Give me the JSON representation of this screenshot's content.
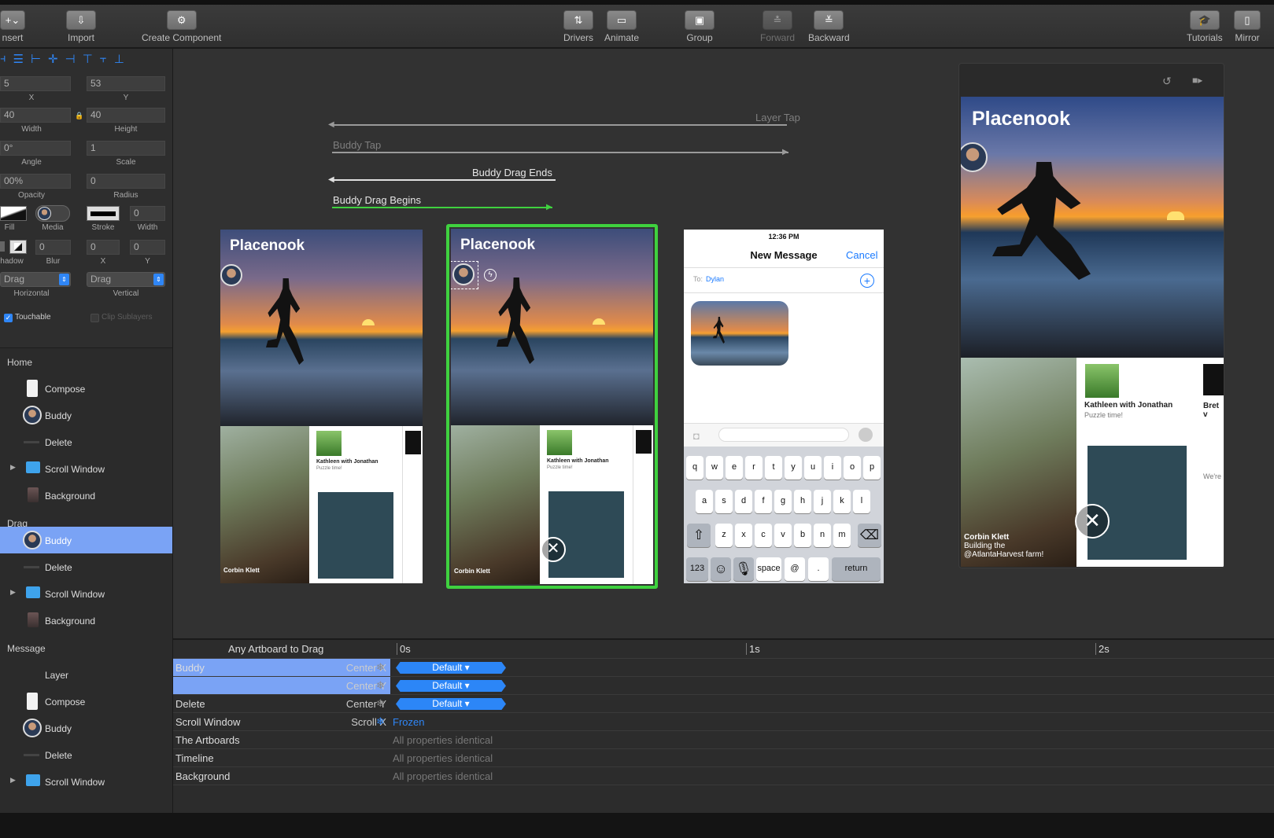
{
  "toolbar": {
    "insert": "nsert",
    "import": "Import",
    "create_component": "Create Component",
    "drivers": "Drivers",
    "animate": "Animate",
    "group": "Group",
    "forward": "Forward",
    "backward": "Backward",
    "tutorials": "Tutorials",
    "mirror": "Mirror"
  },
  "inspector": {
    "x_value": "5",
    "y_value": "53",
    "x_label": "X",
    "y_label": "Y",
    "width_value": "40",
    "height_value": "40",
    "width_label": "Width",
    "height_label": "Height",
    "angle_value": "0°",
    "scale_value": "1",
    "angle_label": "Angle",
    "scale_label": "Scale",
    "opacity_value": "00%",
    "radius_value": "0",
    "opacity_label": "Opacity",
    "radius_label": "Radius",
    "fill_label": "Fill",
    "media_label": "Media",
    "stroke_label": "Stroke",
    "stroke_width_value": "0",
    "stroke_width_label": "Width",
    "blur_value": "0",
    "shadow_x_value": "0",
    "shadow_y_value": "0",
    "shadow_label": "hadow",
    "blur_label": "Blur",
    "shadow_x_label": "X",
    "shadow_y_label": "Y",
    "horizontal_select": "Drag",
    "vertical_select": "Drag",
    "horizontal_label": "Horizontal",
    "vertical_label": "Vertical",
    "touchable_label": "Touchable",
    "clip_sublayers_label": "Clip Sublayers"
  },
  "layers": {
    "home": "Home",
    "home_compose": "Compose",
    "home_buddy": "Buddy",
    "home_delete": "Delete",
    "home_scroll": "Scroll Window",
    "home_background": "Background",
    "drag": "Drag",
    "drag_buddy": "Buddy",
    "drag_delete": "Delete",
    "drag_scroll": "Scroll Window",
    "drag_background": "Background",
    "message": "Message",
    "msg_layer": "Layer",
    "msg_compose": "Compose",
    "msg_buddy": "Buddy",
    "msg_delete": "Delete",
    "msg_scroll": "Scroll Window"
  },
  "canvas": {
    "layer_tap": "Layer Tap",
    "buddy_tap": "Buddy Tap",
    "buddy_drag_ends": "Buddy Drag Ends",
    "buddy_drag_begins": "Buddy Drag Begins",
    "app_title": "Placenook",
    "card_name": "Corbin Klett",
    "card_caption_1": "Building the",
    "card_caption_2": "@AtlantaHarvest farm!",
    "card2_title": "Kathleen with Jonathan",
    "card2_sub": "Puzzle time!",
    "card3_title": "Bret v",
    "card3_sub": "We're",
    "msg_time": "12:36 PM",
    "msg_title": "New Message",
    "msg_cancel": "Cancel",
    "msg_to_label": "To:",
    "msg_to_value": "Dylan",
    "kb_row1": [
      "q",
      "w",
      "e",
      "r",
      "t",
      "y",
      "u",
      "i",
      "o",
      "p"
    ],
    "kb_row2": [
      "a",
      "s",
      "d",
      "f",
      "g",
      "h",
      "j",
      "k",
      "l"
    ],
    "kb_row3": [
      "z",
      "x",
      "c",
      "v",
      "b",
      "n",
      "m"
    ],
    "kb_123": "123",
    "kb_space": "space",
    "kb_at": "@",
    "kb_dot": ".",
    "kb_return": "return",
    "preview_title": "Placenook",
    "preview_card3": "Bret v"
  },
  "timeline": {
    "header_label": "Any Artboard to Drag",
    "t0": "0s",
    "t1": "1s",
    "t2": "2s",
    "rows": [
      {
        "name": "Buddy",
        "prop": "Center X",
        "value": "Default ▾"
      },
      {
        "name": "",
        "prop": "Center Y",
        "value": "Default ▾"
      },
      {
        "name": "Delete",
        "prop": "Center Y",
        "value": "Default ▾"
      },
      {
        "name": "Scroll Window",
        "prop": "Scroll X",
        "value": "Frozen"
      },
      {
        "name": "The Artboards",
        "prop": "",
        "value": "All properties identical"
      },
      {
        "name": "Timeline",
        "prop": "",
        "value": "All properties identical"
      },
      {
        "name": "Background",
        "prop": "",
        "value": "All properties identical"
      }
    ]
  },
  "colors": {
    "accent": "#2f86f6",
    "selection": "#7aa3f5",
    "highlight_frame": "#3fd13f"
  }
}
